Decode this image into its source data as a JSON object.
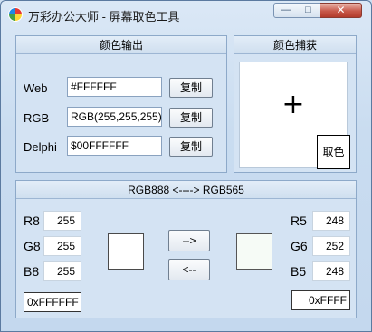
{
  "window": {
    "title": "万彩办公大师 - 屏幕取色工具",
    "minimize_glyph": "—",
    "maximize_glyph": "□",
    "close_glyph": "✕"
  },
  "output_panel": {
    "title": "颜色输出",
    "rows": [
      {
        "label": "Web",
        "value": "#FFFFFF",
        "button": "复制"
      },
      {
        "label": "RGB",
        "value": "RGB(255,255,255)",
        "button": "复制"
      },
      {
        "label": "Delphi",
        "value": "$00FFFFFF",
        "button": "复制"
      }
    ]
  },
  "capture_panel": {
    "title": "颜色捕获",
    "crosshair": "+",
    "pick_button": "取色"
  },
  "convert_panel": {
    "title": "RGB888 <----> RGB565",
    "rgb888": {
      "r_label": "R8",
      "r": "255",
      "g_label": "G8",
      "g": "255",
      "b_label": "B8",
      "b": "255",
      "hex": "0xFFFFFF"
    },
    "rgb565": {
      "r_label": "R5",
      "r": "248",
      "g_label": "G6",
      "g": "252",
      "b_label": "B5",
      "b": "248",
      "hex": "0xFFFF"
    },
    "to565_button": "-->",
    "to888_button": "<--",
    "swatch_888_color": "#FFFFFF",
    "swatch_565_color": "#F6FBF6"
  }
}
